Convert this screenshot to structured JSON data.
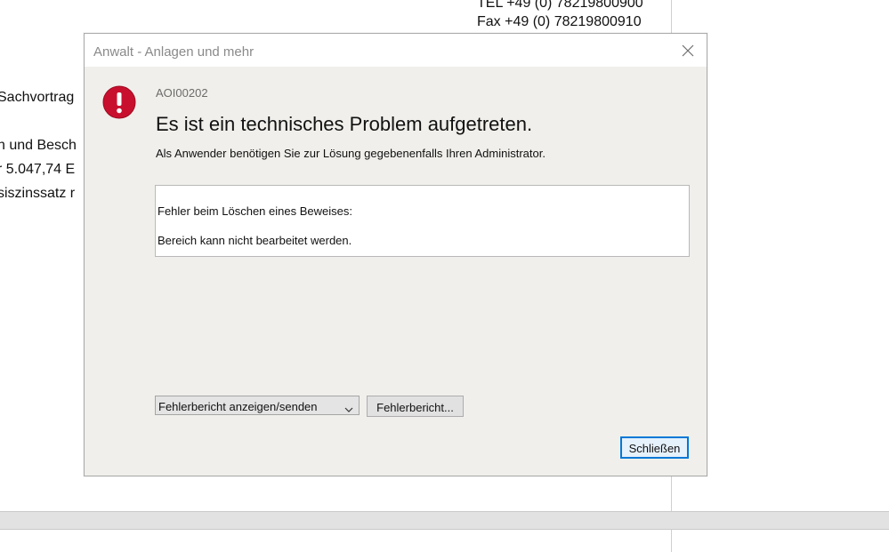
{
  "background_document": {
    "tel": "TEL +49 (0) 78219800900",
    "fax": "Fax +49 (0) 78219800910",
    "lines": [
      "Sachvortrag",
      "n und Besch",
      "r 5.047,74 E",
      "siszinssatz r"
    ]
  },
  "dialog": {
    "title": "Anwalt - Anlagen und mehr",
    "code": "AOI00202",
    "heading": "Es ist ein technisches Problem aufgetreten.",
    "subtitle": "Als Anwender benötigen Sie zur Lösung gegebenenfalls Ihren Administrator.",
    "details": [
      "Fehler beim Löschen eines Beweises:",
      "Bereich kann nicht bearbeitet werden."
    ],
    "report_select": {
      "selected": "Fehlerbericht anzeigen/senden"
    },
    "report_button": "Fehlerbericht...",
    "close_button": "Schließen"
  },
  "icons": {
    "close": "close-icon",
    "error": "error-icon",
    "dropdown": "chevron-down-icon"
  },
  "colors": {
    "error_red": "#c8102e",
    "accent_blue": "#0078d7",
    "dialog_bg": "#f0efeb"
  }
}
